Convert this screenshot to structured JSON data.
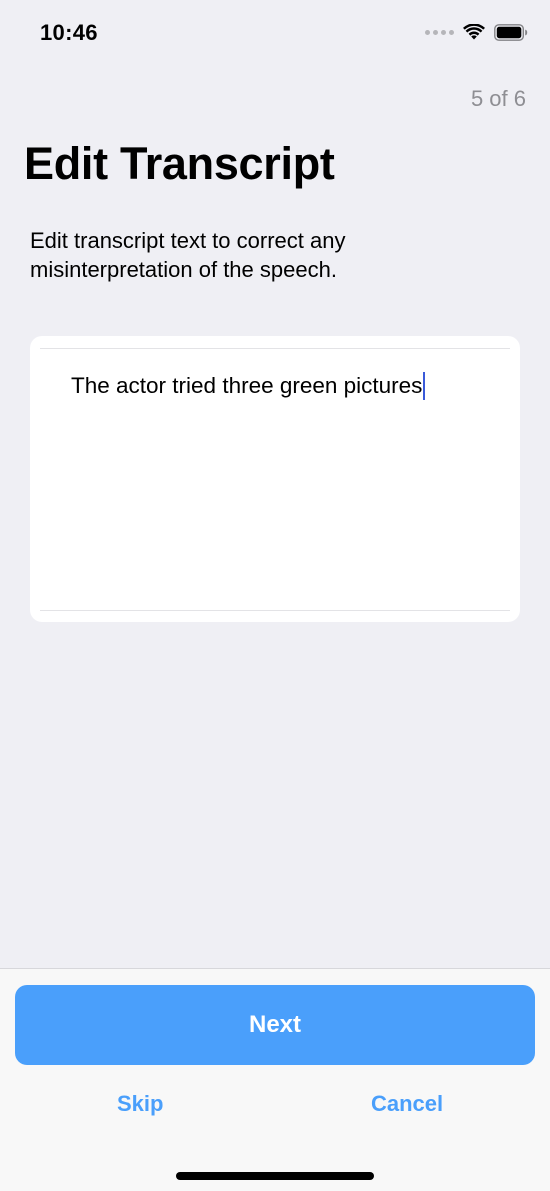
{
  "status_bar": {
    "time": "10:46",
    "icons": [
      "cellular-signal-icon",
      "wifi-icon",
      "battery-icon"
    ]
  },
  "header": {
    "step": "5 of 6"
  },
  "main": {
    "title": "Edit Transcript",
    "description": "Edit transcript text to correct any misinterpretation of the speech.",
    "transcript_value": "The actor tried three green pictures"
  },
  "footer": {
    "next_label": "Next",
    "skip_label": "Skip",
    "cancel_label": "Cancel"
  },
  "colors": {
    "background": "#efeff4",
    "accent": "#4a9ffb",
    "caret": "#3a5ad9",
    "secondary_text": "#8e8e93"
  }
}
